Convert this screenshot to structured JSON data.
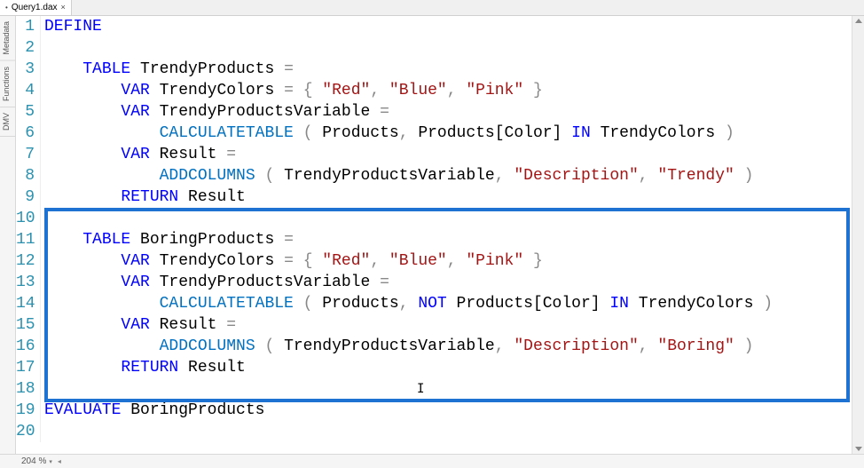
{
  "tab": {
    "title": "Query1.dax",
    "dirty_marker": "•"
  },
  "side_tabs": [
    "Metadata",
    "Functions",
    "DMV"
  ],
  "status": {
    "zoom": "204 %"
  },
  "code": {
    "styles": {
      "kw": "keyword",
      "fn": "function",
      "str": "string",
      "id": "identifier",
      "op": "operator"
    },
    "lines": [
      [
        {
          "c": "kw",
          "t": "DEFINE"
        }
      ],
      [],
      [
        {
          "c": "id",
          "t": "    "
        },
        {
          "c": "kw",
          "t": "TABLE"
        },
        {
          "c": "id",
          "t": " TrendyProducts "
        },
        {
          "c": "op",
          "t": "="
        }
      ],
      [
        {
          "c": "id",
          "t": "        "
        },
        {
          "c": "kw",
          "t": "VAR"
        },
        {
          "c": "id",
          "t": " TrendyColors "
        },
        {
          "c": "op",
          "t": "="
        },
        {
          "c": "id",
          "t": " "
        },
        {
          "c": "op",
          "t": "{ "
        },
        {
          "c": "str",
          "t": "\"Red\""
        },
        {
          "c": "op",
          "t": ", "
        },
        {
          "c": "str",
          "t": "\"Blue\""
        },
        {
          "c": "op",
          "t": ", "
        },
        {
          "c": "str",
          "t": "\"Pink\""
        },
        {
          "c": "op",
          "t": " }"
        }
      ],
      [
        {
          "c": "id",
          "t": "        "
        },
        {
          "c": "kw",
          "t": "VAR"
        },
        {
          "c": "id",
          "t": " TrendyProductsVariable "
        },
        {
          "c": "op",
          "t": "="
        }
      ],
      [
        {
          "c": "id",
          "t": "            "
        },
        {
          "c": "fn",
          "t": "CALCULATETABLE"
        },
        {
          "c": "id",
          "t": " "
        },
        {
          "c": "op",
          "t": "("
        },
        {
          "c": "id",
          "t": " Products"
        },
        {
          "c": "op",
          "t": ","
        },
        {
          "c": "id",
          "t": " Products[Color] "
        },
        {
          "c": "kw",
          "t": "IN"
        },
        {
          "c": "id",
          "t": " TrendyColors "
        },
        {
          "c": "op",
          "t": ")"
        }
      ],
      [
        {
          "c": "id",
          "t": "        "
        },
        {
          "c": "kw",
          "t": "VAR"
        },
        {
          "c": "id",
          "t": " Result "
        },
        {
          "c": "op",
          "t": "="
        }
      ],
      [
        {
          "c": "id",
          "t": "            "
        },
        {
          "c": "fn",
          "t": "ADDCOLUMNS"
        },
        {
          "c": "id",
          "t": " "
        },
        {
          "c": "op",
          "t": "("
        },
        {
          "c": "id",
          "t": " TrendyProductsVariable"
        },
        {
          "c": "op",
          "t": ", "
        },
        {
          "c": "str",
          "t": "\"Description\""
        },
        {
          "c": "op",
          "t": ", "
        },
        {
          "c": "str",
          "t": "\"Trendy\""
        },
        {
          "c": "id",
          "t": " "
        },
        {
          "c": "op",
          "t": ")"
        }
      ],
      [
        {
          "c": "id",
          "t": "        "
        },
        {
          "c": "kw",
          "t": "RETURN"
        },
        {
          "c": "id",
          "t": " Result"
        }
      ],
      [],
      [
        {
          "c": "id",
          "t": "    "
        },
        {
          "c": "kw",
          "t": "TABLE"
        },
        {
          "c": "id",
          "t": " BoringProducts "
        },
        {
          "c": "op",
          "t": "="
        }
      ],
      [
        {
          "c": "id",
          "t": "        "
        },
        {
          "c": "kw",
          "t": "VAR"
        },
        {
          "c": "id",
          "t": " TrendyColors "
        },
        {
          "c": "op",
          "t": "="
        },
        {
          "c": "id",
          "t": " "
        },
        {
          "c": "op",
          "t": "{ "
        },
        {
          "c": "str",
          "t": "\"Red\""
        },
        {
          "c": "op",
          "t": ", "
        },
        {
          "c": "str",
          "t": "\"Blue\""
        },
        {
          "c": "op",
          "t": ", "
        },
        {
          "c": "str",
          "t": "\"Pink\""
        },
        {
          "c": "op",
          "t": " }"
        }
      ],
      [
        {
          "c": "id",
          "t": "        "
        },
        {
          "c": "kw",
          "t": "VAR"
        },
        {
          "c": "id",
          "t": " TrendyProductsVariable "
        },
        {
          "c": "op",
          "t": "="
        }
      ],
      [
        {
          "c": "id",
          "t": "            "
        },
        {
          "c": "fn",
          "t": "CALCULATETABLE"
        },
        {
          "c": "id",
          "t": " "
        },
        {
          "c": "op",
          "t": "("
        },
        {
          "c": "id",
          "t": " Products"
        },
        {
          "c": "op",
          "t": ", "
        },
        {
          "c": "kw",
          "t": "NOT"
        },
        {
          "c": "id",
          "t": " Products[Color] "
        },
        {
          "c": "kw",
          "t": "IN"
        },
        {
          "c": "id",
          "t": " TrendyColors "
        },
        {
          "c": "op",
          "t": ")"
        }
      ],
      [
        {
          "c": "id",
          "t": "        "
        },
        {
          "c": "kw",
          "t": "VAR"
        },
        {
          "c": "id",
          "t": " Result "
        },
        {
          "c": "op",
          "t": "="
        }
      ],
      [
        {
          "c": "id",
          "t": "            "
        },
        {
          "c": "fn",
          "t": "ADDCOLUMNS"
        },
        {
          "c": "id",
          "t": " "
        },
        {
          "c": "op",
          "t": "("
        },
        {
          "c": "id",
          "t": " TrendyProductsVariable"
        },
        {
          "c": "op",
          "t": ", "
        },
        {
          "c": "str",
          "t": "\"Description\""
        },
        {
          "c": "op",
          "t": ", "
        },
        {
          "c": "str",
          "t": "\"Boring\""
        },
        {
          "c": "id",
          "t": " "
        },
        {
          "c": "op",
          "t": ")"
        }
      ],
      [
        {
          "c": "id",
          "t": "        "
        },
        {
          "c": "kw",
          "t": "RETURN"
        },
        {
          "c": "id",
          "t": " Result"
        }
      ],
      [],
      [
        {
          "c": "kw",
          "t": "EVALUATE"
        },
        {
          "c": "id",
          "t": " BoringProducts"
        }
      ],
      []
    ]
  }
}
